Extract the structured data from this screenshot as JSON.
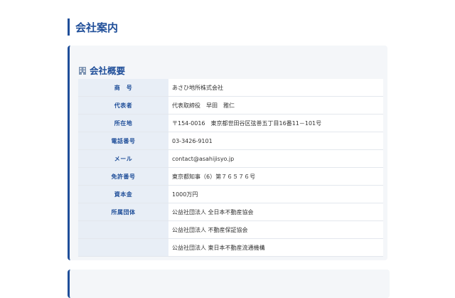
{
  "page_title": "会社案内",
  "overview": {
    "icon": "building-icon",
    "title": "会社概要",
    "rows": [
      {
        "label": "商　号",
        "value": "あさひ地所株式会社"
      },
      {
        "label": "代表者",
        "value": "代表取締役　早田　雅仁"
      },
      {
        "label": "所在地",
        "value": "〒154-0016　東京都世田谷区弦巻五丁目16番11－101号"
      },
      {
        "label": "電話番号",
        "value": "03-3426-9101"
      },
      {
        "label": "メール",
        "value": "contact@asahijisyo.jp"
      },
      {
        "label": "免許番号",
        "value": "東京都知事（6）第７６５７６号"
      },
      {
        "label": "資本金",
        "value": "1000万円"
      },
      {
        "label": "所属団体",
        "value": "公益社団法人 全日本不動産協会"
      },
      {
        "label": "",
        "value": "公益社団法人 不動産保証協会"
      },
      {
        "label": "",
        "value": "公益社団法人 東日本不動産流通機構"
      }
    ]
  },
  "colors": {
    "accent": "#1f4e99",
    "label_bg": "#e8eef6",
    "card_bg": "#f4f6f9"
  }
}
